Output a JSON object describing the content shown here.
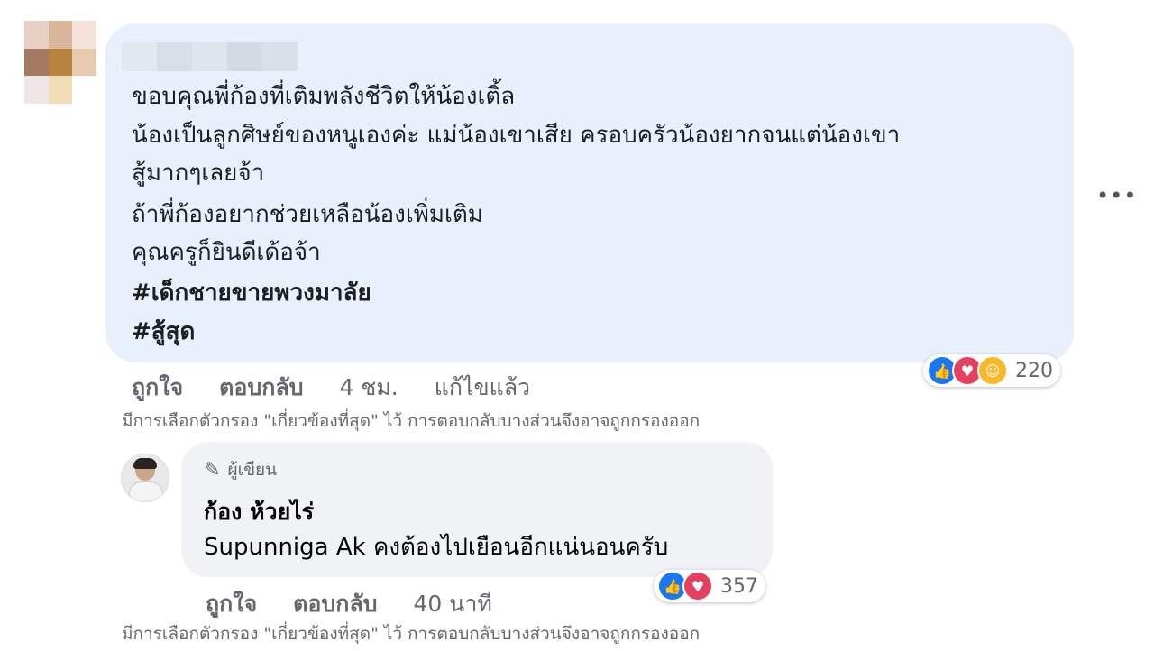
{
  "comment": {
    "lines": [
      "ขอบคุณพี่ก้องที่เติมพลังชีวิตให้น้องเติ้ล",
      "น้องเป็นลูกศิษย์ของหนูเองค่ะ แม่น้องเขาเสีย ครอบครัวน้องยากจนแต่น้องเขา",
      "สู้มากๆเลยจ้า",
      "ถ้าพี่ก้องอยากช่วยเหลือน้องเพิ่มเติม",
      "คุณครูก็ยินดีเด้อจ้า"
    ],
    "hashtags": [
      "#เด็กชายขายพวงมาลัย",
      "#สู้สุด"
    ],
    "actions": {
      "like": "ถูกใจ",
      "reply": "ตอบกลับ",
      "time": "4 ชม.",
      "edited": "แก้ไขแล้ว"
    },
    "reaction_count": "220",
    "reaction_icons": [
      "like-icon",
      "love-icon",
      "care-icon"
    ],
    "filter_note": "มีการเลือกตัวกรอง \"เกี่ยวข้องที่สุด\" ไว้ การตอบกลับบางส่วนจึงอาจถูกกรองออก"
  },
  "reply": {
    "badge": "ผู้เขียน",
    "author": "ก้อง ห้วยไร่",
    "text": "Supunniga Ak คงต้องไปเยือนอีกแน่นอนครับ",
    "actions": {
      "like": "ถูกใจ",
      "reply": "ตอบกลับ",
      "time": "40 นาที"
    },
    "reaction_count": "357",
    "reaction_icons": [
      "like-icon",
      "love-icon"
    ],
    "filter_note": "มีการเลือกตัวกรอง \"เกี่ยวข้องที่สุด\" ไว้ การตอบกลับบางส่วนจึงอาจถูกกรองออก"
  },
  "colors": {
    "bubble_primary": "#e7f0fb",
    "bubble_reply": "#f0f2f5",
    "like": "#1877f2",
    "love": "#e4405f",
    "care": "#f7b928",
    "muted_text": "#65676b"
  }
}
